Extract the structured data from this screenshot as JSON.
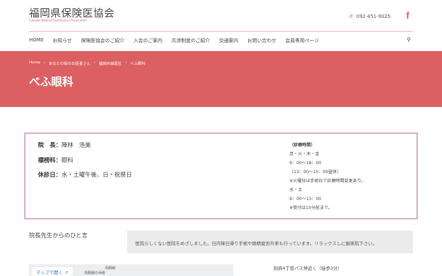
{
  "header": {
    "logo": "福岡県保険医協会",
    "logo_sub": "Fukuoka Medical Practitioners Association",
    "phone": "092-451-9025",
    "phone_icon": "phone-icon",
    "facebook": "f"
  },
  "nav": [
    "HOME",
    "お知らせ",
    "保険医協会のご紹介",
    "入会のご案内",
    "共済制度のご紹介",
    "交通案内",
    "お問い合わせ",
    "会員専用ページ"
  ],
  "breadcrumb": [
    "Home",
    "あなたの街のお医者さん",
    "福岡市城南区",
    "べふ眼科"
  ],
  "page_title": "べふ眼科",
  "info": {
    "director_label": "院　長：",
    "director": "陣林　浩美",
    "dept_label": "標榜科：",
    "dept": "眼科",
    "closed_label": "休診日：",
    "closed": "水・土曜午後、日・祝祭日",
    "hours": [
      "（診療時間）",
      "月・火・木・金",
      "9：00〜18：00",
      "（13：00〜15：00昼休）",
      "※火曜日は手術日で診療時間変更あり。",
      "水・土",
      "9：00〜13：00",
      "※受付は10分前まで。"
    ]
  },
  "message": {
    "heading": "院長先生からのひと言",
    "text": "医院らしくない医院をめざしました。日内障日帰り手術や眼精疲労外来も行っています。リラックスしに御来院下さい。"
  },
  "map": {
    "open_label": "マップで開く ↗",
    "roads": [
      "鳥飼線",
      "鳥飼線の浜線"
    ]
  },
  "access": "別府4丁目バス停近く（徒歩3分）"
}
